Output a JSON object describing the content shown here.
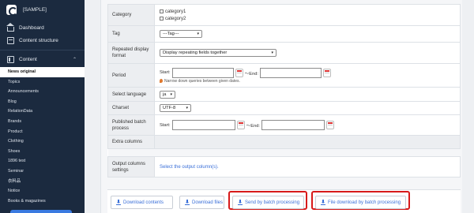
{
  "sidebar": {
    "site_name": "[SAMPLE]",
    "nav": [
      {
        "label": "Dashboard",
        "icon": "home-icon"
      },
      {
        "label": "Content structure",
        "icon": "structure-icon"
      }
    ],
    "content_section": {
      "label": "Content",
      "icon": "content-icon"
    },
    "items": [
      "News original",
      "Topics",
      "Announcements",
      "Blog",
      "RelationData",
      "Brands",
      "Product",
      "Clothing",
      "Shoes",
      "1896 test",
      "Seminar",
      "衣料品",
      "Notice",
      "Books & magazines"
    ],
    "active_item": "News original"
  },
  "form": {
    "category": {
      "label": "Category",
      "options": [
        "category1",
        "category2"
      ]
    },
    "tag": {
      "label": "Tag",
      "value": "---Tag---"
    },
    "repeated": {
      "label": "Repeated display format",
      "value": "Display repeating fields together"
    },
    "period": {
      "label": "Period",
      "start_label": "Start:",
      "end_label": "〜End:",
      "hint": "Narrow down queries between given dates."
    },
    "language": {
      "label": "Select language",
      "value": "ja"
    },
    "charset": {
      "label": "Charset",
      "value": "UTF-8"
    },
    "published": {
      "label": "Published batch process",
      "start_label": "Start:",
      "end_label": "〜End:"
    },
    "extra": {
      "label": "Extra columns"
    },
    "output": {
      "label": "Output columns settings",
      "link": "Select the output column(s)."
    }
  },
  "buttons": {
    "download_contents": "Download contents",
    "download_files": "Download files",
    "send_batch": "Send by batch processing",
    "file_download_batch": "File download by batch processing"
  },
  "colors": {
    "sidebar_bg": "#1b2a3f",
    "accent": "#3a6fd8",
    "highlight": "#d71a1a"
  }
}
